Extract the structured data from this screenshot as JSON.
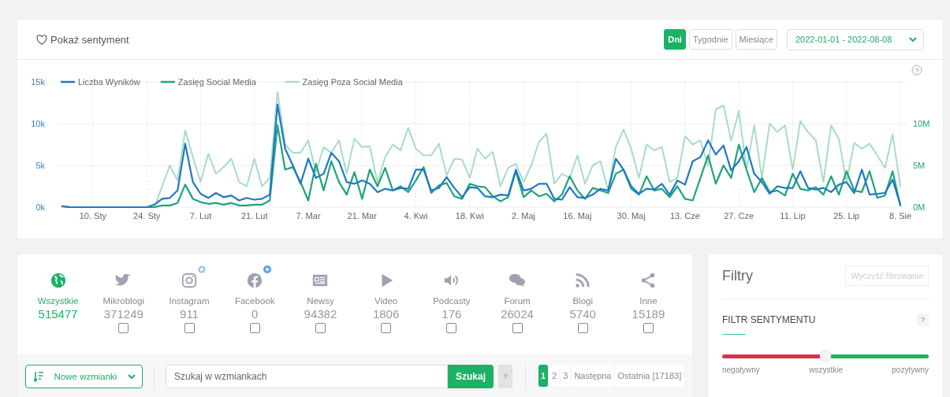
{
  "chart_panel": {
    "sentiment_toggle": "Pokaż sentyment",
    "intervals": [
      {
        "label": "Dni",
        "selected": true
      },
      {
        "label": "Tygodnie",
        "selected": false
      },
      {
        "label": "Miesiące",
        "selected": false
      }
    ],
    "date_range": "2022-01-01 - 2022-08-08",
    "help": "?",
    "chart_data": {
      "type": "line",
      "grid": true,
      "legend": "top-left",
      "categories": [
        null,
        null,
        null,
        null,
        "10. Sty",
        null,
        null,
        null,
        null,
        null,
        null,
        "24. Sty",
        null,
        null,
        null,
        null,
        null,
        null,
        "7. Lut",
        null,
        null,
        null,
        null,
        null,
        null,
        "21. Lut",
        null,
        null,
        null,
        null,
        null,
        null,
        "7. Mar",
        null,
        null,
        null,
        null,
        null,
        null,
        "21. Mar",
        null,
        null,
        null,
        null,
        null,
        null,
        "4. Kwi",
        null,
        null,
        null,
        null,
        null,
        null,
        "18. Kwi",
        null,
        null,
        null,
        null,
        null,
        null,
        "2. Maj",
        null,
        null,
        null,
        null,
        null,
        null,
        "16. Maj",
        null,
        null,
        null,
        null,
        null,
        null,
        "30. Maj",
        null,
        null,
        null,
        null,
        null,
        null,
        "13. Cze",
        null,
        null,
        null,
        null,
        null,
        null,
        "27. Cze",
        null,
        null,
        null,
        null,
        null,
        null,
        "11. Lip",
        null,
        null,
        null,
        null,
        null,
        null,
        "25. Lip",
        null,
        null,
        null,
        null,
        null,
        null,
        "8. Sie"
      ],
      "ylim": [
        0,
        15000
      ],
      "yticks": [
        {
          "value": 0,
          "label": "0k"
        },
        {
          "value": 5000,
          "label": "5k"
        },
        {
          "value": 10000,
          "label": "10k"
        },
        {
          "value": 15000,
          "label": "15k"
        }
      ],
      "y2lim": [
        0,
        15000000
      ],
      "y2ticks": [
        {
          "value": 0,
          "label": "0M"
        },
        {
          "value": 5000000,
          "label": "5M"
        },
        {
          "value": 10000000,
          "label": "10M"
        }
      ],
      "series": [
        {
          "name": "Liczba Wyników",
          "color": "#1f77c9",
          "axis": "y",
          "values": [
            100,
            0,
            0,
            0,
            0,
            0,
            0,
            0,
            0,
            0,
            0,
            0,
            300,
            1000,
            1100,
            2000,
            7600,
            3000,
            1600,
            1100,
            1700,
            1200,
            1400,
            800,
            1100,
            900,
            1000,
            1500,
            12300,
            7000,
            5000,
            2800,
            5800,
            3500,
            4000,
            6500,
            5500,
            3000,
            2800,
            3200,
            2800,
            1800,
            2200,
            2000,
            2300,
            2200,
            4500,
            4500,
            2000,
            2300,
            3600,
            2300,
            1200,
            2400,
            2300,
            1300,
            1200,
            1500,
            1400,
            4500,
            2000,
            2200,
            2800,
            2800,
            1000,
            900,
            2400,
            1200,
            1100,
            1500,
            2200,
            2000,
            5800,
            4500,
            2500,
            1600,
            2200,
            2100,
            2800,
            1500,
            3200,
            2700,
            5500,
            6000,
            8000,
            6300,
            7400,
            4400,
            5500,
            7200,
            4000,
            3000,
            1600,
            2500,
            2300,
            2300,
            4300,
            2300,
            2100,
            2300,
            1800,
            2700,
            3000,
            1700,
            4500,
            1500,
            1600,
            1700,
            3300,
            300
          ]
        },
        {
          "name": "Zasięg Social Media",
          "color": "#1fa37a",
          "axis": "y",
          "values": [
            100,
            0,
            0,
            0,
            0,
            0,
            0,
            0,
            0,
            0,
            0,
            0,
            0,
            200,
            200,
            500,
            2700,
            1000,
            600,
            400,
            500,
            300,
            500,
            200,
            200,
            300,
            300,
            800,
            9800,
            4500,
            4800,
            3000,
            800,
            5200,
            2000,
            5500,
            3000,
            1500,
            4200,
            1000,
            4500,
            2500,
            4700,
            2000,
            2500,
            1800,
            3200,
            4800,
            1700,
            2600,
            2900,
            1300,
            1000,
            2800,
            2500,
            2400,
            1300,
            700,
            1200,
            4300,
            1200,
            2000,
            1300,
            1600,
            700,
            1500,
            3700,
            2000,
            1000,
            2300,
            2000,
            1700,
            4000,
            4500,
            2200,
            1500,
            3700,
            2000,
            2200,
            1200,
            2500,
            1000,
            800,
            3500,
            6200,
            2800,
            5000,
            3500,
            7500,
            4500,
            1800,
            3500,
            1800,
            2000,
            1400,
            4000,
            2200,
            2000,
            2400,
            1500,
            3700,
            1500,
            4300,
            2000,
            1800,
            4300,
            1100,
            1400,
            4300,
            200
          ]
        },
        {
          "name": "Zasięg Poza Social Media",
          "color": "#a8dcc4",
          "axis": "y2",
          "values": [
            100000,
            0,
            0,
            0,
            0,
            0,
            0,
            0,
            0,
            0,
            0,
            0,
            0,
            2500000,
            5000000,
            3200000,
            9200000,
            6000000,
            3000000,
            6400000,
            4000000,
            4800000,
            5800000,
            3000000,
            2500000,
            5800000,
            2500000,
            3500000,
            13800000,
            7500000,
            6500000,
            6500000,
            8000000,
            4200000,
            7200000,
            6500000,
            8000000,
            4000000,
            8200000,
            7200000,
            7300000,
            3000000,
            6000000,
            7500000,
            6800000,
            9500000,
            7000000,
            6200000,
            6200000,
            7600000,
            3800000,
            5800000,
            5700000,
            3500000,
            7000000,
            5800000,
            6600000,
            2500000,
            4700000,
            5200000,
            3000000,
            5000000,
            7800000,
            8800000,
            2800000,
            4000000,
            3500000,
            6200000,
            2800000,
            5000000,
            5500000,
            2000000,
            7200000,
            9300000,
            7000000,
            3500000,
            7500000,
            6800000,
            7200000,
            3000000,
            3500000,
            8500000,
            7500000,
            8000000,
            5000000,
            11700000,
            12200000,
            8000000,
            11500000,
            4500000,
            9800000,
            3500000,
            10000000,
            9000000,
            9800000,
            4500000,
            10300000,
            9000000,
            8000000,
            3000000,
            9800000,
            8200000,
            3000000,
            7700000,
            7000000,
            7600000,
            6200000,
            4700000,
            8700000,
            2500000
          ]
        }
      ]
    }
  },
  "sources": [
    {
      "kind": "all",
      "label": "Wszystkie",
      "count": "515477",
      "selected": true,
      "settings_badge": false,
      "add_badge": false
    },
    {
      "kind": "microblog",
      "label": "Mikroblogi",
      "count": "371249",
      "selected": false,
      "checked": false,
      "settings_badge": false,
      "add_badge": false
    },
    {
      "kind": "instagram",
      "label": "Instagram",
      "count": "911",
      "selected": false,
      "checked": false,
      "settings_badge": true,
      "add_badge": false
    },
    {
      "kind": "facebook",
      "label": "Facebook",
      "count": "0",
      "selected": false,
      "checked": false,
      "settings_badge": false,
      "add_badge": true
    },
    {
      "kind": "news",
      "label": "Newsy",
      "count": "94382",
      "selected": false,
      "checked": false,
      "settings_badge": false,
      "add_badge": false
    },
    {
      "kind": "video",
      "label": "Video",
      "count": "1806",
      "selected": false,
      "checked": false,
      "settings_badge": false,
      "add_badge": false
    },
    {
      "kind": "podcast",
      "label": "Podcasty",
      "count": "176",
      "selected": false,
      "checked": false,
      "settings_badge": false,
      "add_badge": false
    },
    {
      "kind": "forum",
      "label": "Forum",
      "count": "26024",
      "selected": false,
      "checked": false,
      "settings_badge": false,
      "add_badge": false
    },
    {
      "kind": "blog",
      "label": "Blogi",
      "count": "5740",
      "selected": false,
      "checked": false,
      "settings_badge": false,
      "add_badge": false
    },
    {
      "kind": "other",
      "label": "Inne",
      "count": "15189",
      "selected": false,
      "checked": false,
      "settings_badge": false,
      "add_badge": false
    }
  ],
  "toolbar": {
    "sort": "Nowe wzmianki",
    "search": {
      "placeholder": "Szukaj w wzmiankach"
    },
    "search_button": "Szukaj",
    "help": "?",
    "pages": [
      {
        "label": "1",
        "selected": true
      },
      {
        "label": "2",
        "selected": false
      },
      {
        "label": "3",
        "selected": false
      },
      {
        "label": "Następna",
        "selected": false
      },
      {
        "label": "Ostatnia [17183]",
        "selected": false
      }
    ]
  },
  "filters": {
    "title": "Filtry",
    "clear_button": {
      "label": "Wyczyść filtrowanie",
      "disabled": true
    },
    "sentiment": {
      "title": "FILTR SENTYMENTU",
      "help": "?",
      "level": 0.5,
      "labels": [
        "negatywny",
        "wszystkie",
        "pozytywny"
      ]
    }
  }
}
